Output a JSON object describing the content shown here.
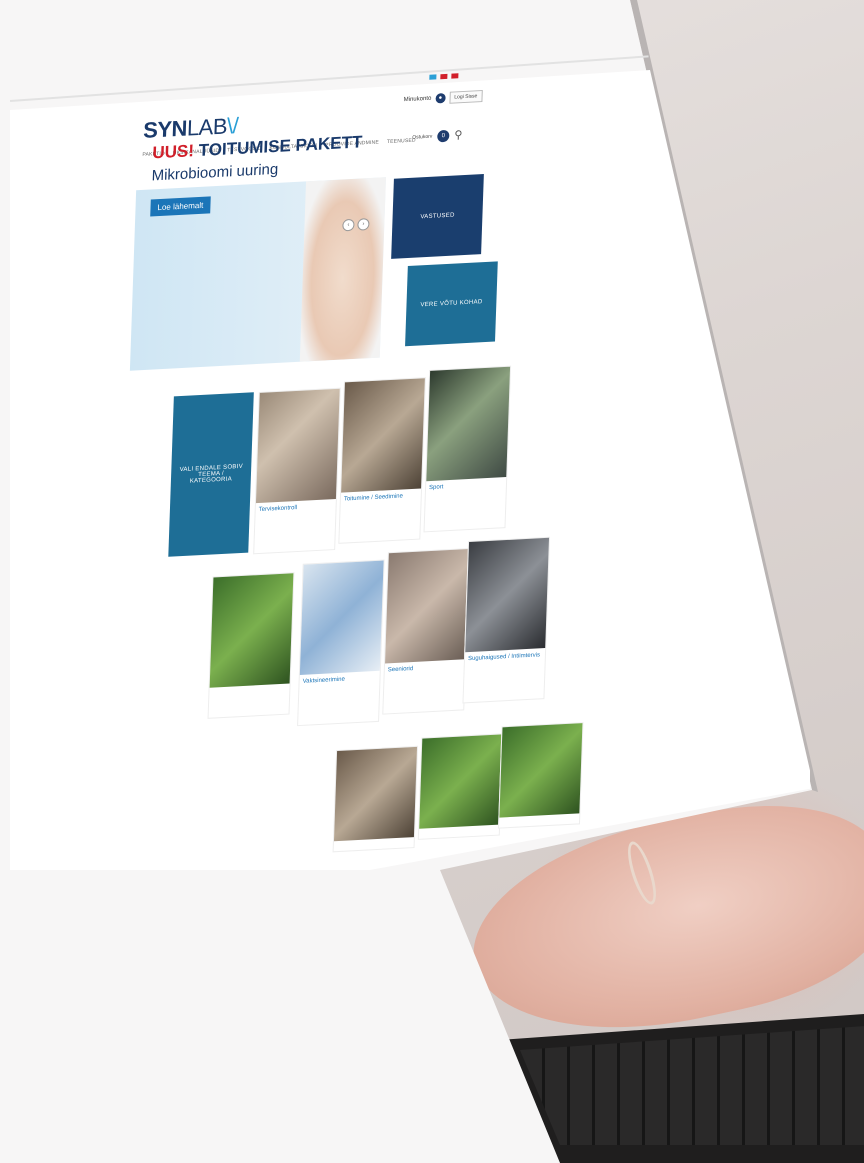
{
  "brand": {
    "prefix": "SYN",
    "suffix": "LAB",
    "mark": "\\/"
  },
  "header": {
    "flags": [
      "#2a9fd6",
      "#d11f2a",
      "#d11f2a"
    ],
    "user_label": "Minukonto",
    "user_icon": "user-icon",
    "login_label": "Logi Sisse",
    "cart_label": "Ostukorv",
    "cart_count": "0"
  },
  "nav": {
    "items": [
      "PAKETID",
      "ÜKSIKANALÜÜSID",
      "TESTVOOSID",
      "KONSULTATSIOON",
      "PROOVIDE ANDMINE",
      "TEENUSED"
    ]
  },
  "banner": {
    "new_word": "UUS!",
    "package_word": "TOITUMISE PAKETT",
    "subtitle": "Mikrobioomi uuring",
    "button": "Loe lähemalt",
    "prev": "‹",
    "next": "›"
  },
  "tiles": {
    "results": "VASTUSED",
    "blood": "VERE VÕTU KOHAD",
    "choose": "VALI ENDALE SOBIV TEEMA / KATEGOORIA"
  },
  "cards": [
    {
      "label": "Tervisekontroll"
    },
    {
      "label": "Toitumine / Seedimine"
    },
    {
      "label": "Sport"
    },
    {
      "label": ""
    },
    {
      "label": "Vaktsineerimine"
    },
    {
      "label": "Seeniorid"
    },
    {
      "label": "Suguhaigused / Intiimtervis"
    },
    {
      "label": ""
    },
    {
      "label": ""
    },
    {
      "label": ""
    }
  ],
  "colors": {
    "brand_navy": "#1a3a6b",
    "brand_blue": "#1b75b8",
    "accent_red": "#d11f2a",
    "tile_teal": "#1e6e96"
  }
}
